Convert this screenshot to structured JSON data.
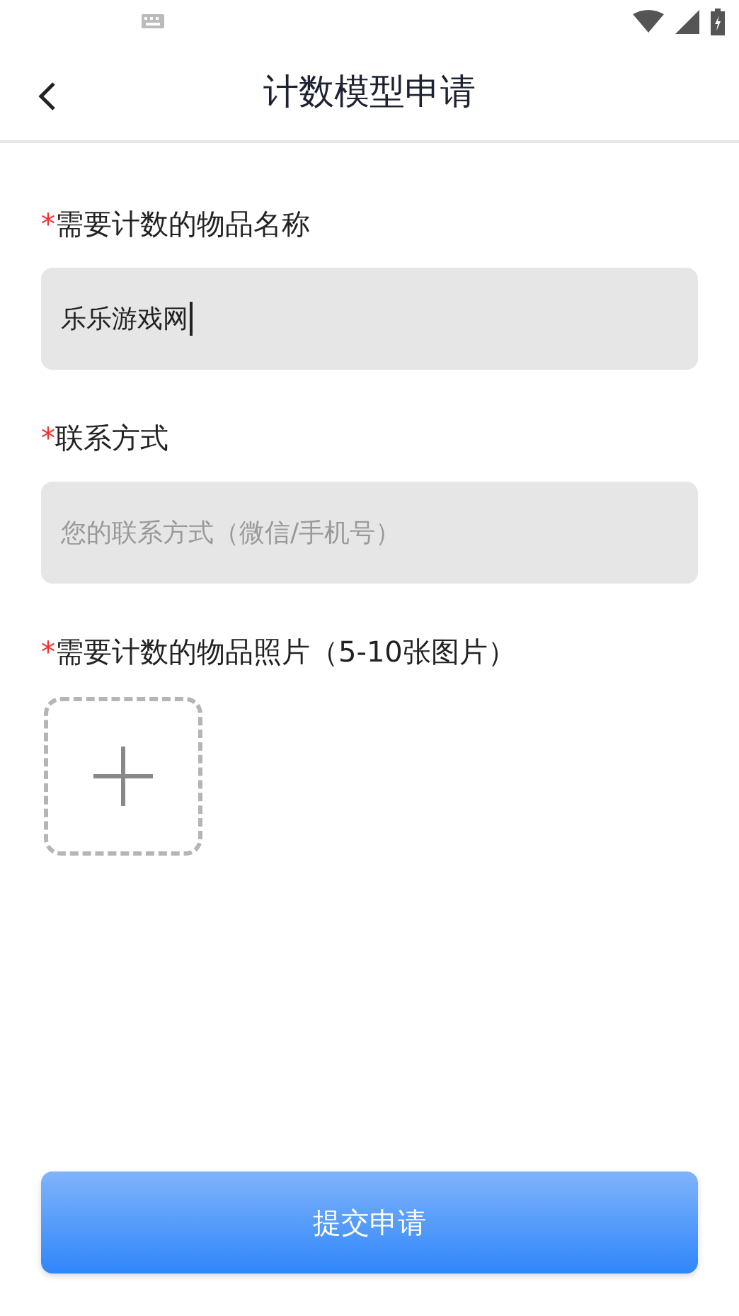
{
  "header": {
    "title": "计数模型申请"
  },
  "fields": [
    {
      "kind": "text",
      "required_mark": "*",
      "label": "需要计数的物品名称",
      "value": "乐乐游戏网",
      "focused": true
    },
    {
      "kind": "text",
      "required_mark": "*",
      "label": "联系方式",
      "placeholder": "您的联系方式（微信/手机号）",
      "focused": false
    },
    {
      "kind": "upload",
      "required_mark": "*",
      "label": "需要计数的物品照片（5-10张图片）"
    }
  ],
  "submit_button": "提交申请"
}
